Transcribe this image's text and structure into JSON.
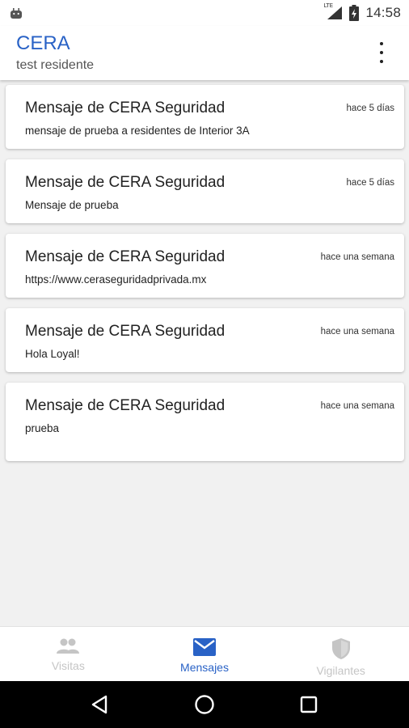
{
  "status_bar": {
    "network_label": "LTE",
    "time": "14:58",
    "icons": [
      "android-icon",
      "signal-icon",
      "battery-icon"
    ]
  },
  "app_bar": {
    "title": "CERA",
    "subtitle": "test residente",
    "menu_icon": "more-vert-icon"
  },
  "messages": [
    {
      "title": "Mensaje de CERA Seguridad",
      "time": "hace 5 días",
      "body": "mensaje de prueba a residentes de Interior 3A"
    },
    {
      "title": "Mensaje de CERA Seguridad",
      "time": "hace 5 días",
      "body": "Mensaje de prueba"
    },
    {
      "title": "Mensaje de CERA Seguridad",
      "time": "hace una semana",
      "body": "https://www.ceraseguridadprivada.mx"
    },
    {
      "title": "Mensaje de CERA Seguridad",
      "time": "hace una semana",
      "body": "Hola Loyal!"
    },
    {
      "title": "Mensaje de CERA Seguridad",
      "time": "hace una semana",
      "body": "prueba"
    }
  ],
  "bottom_nav": {
    "items": [
      {
        "label": "Visitas",
        "icon": "people-icon"
      },
      {
        "label": "Mensajes",
        "icon": "mail-icon"
      },
      {
        "label": "Vigilantes",
        "icon": "shield-icon"
      }
    ],
    "active": "Mensajes"
  },
  "colors": {
    "accent": "#2962c6",
    "inactive": "#c5c5c5",
    "background": "#f1f1f1"
  }
}
